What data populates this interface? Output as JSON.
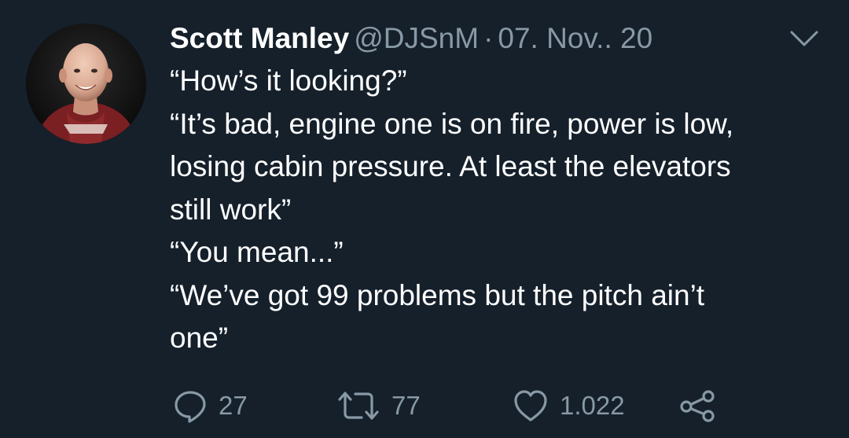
{
  "tweet": {
    "author": {
      "display_name": "Scott Manley",
      "handle": "@DJSnM",
      "avatar_icon": "profile-photo"
    },
    "separator": "·",
    "date": "07. Nov.. 20",
    "menu_icon": "chevron-down-icon",
    "text_lines": [
      "“How’s it looking?”",
      "“It’s bad, engine one is on fire, power is low,",
      "losing cabin pressure. At least the elevators",
      "still work”",
      "“You mean...”",
      "“We’ve got 99 problems but the pitch ain’t",
      "one”"
    ],
    "actions": {
      "reply": {
        "icon": "reply-icon",
        "count": "27"
      },
      "retweet": {
        "icon": "retweet-icon",
        "count": "77"
      },
      "like": {
        "icon": "heart-icon",
        "count": "1.022"
      },
      "share": {
        "icon": "share-icon"
      }
    },
    "colors": {
      "background": "#15202b",
      "primary_text": "#ffffff",
      "secondary_text": "#8899a6"
    }
  }
}
